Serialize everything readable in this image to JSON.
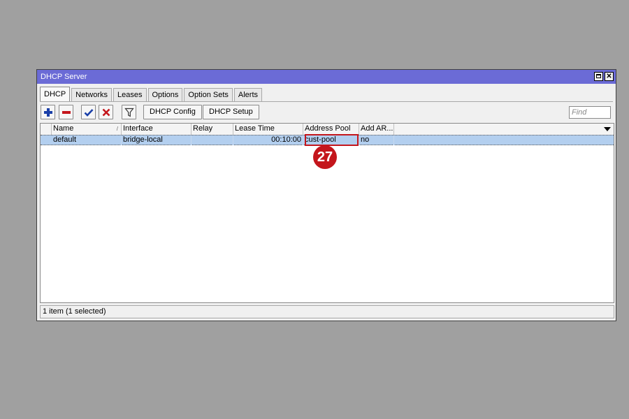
{
  "window": {
    "title": "DHCP Server"
  },
  "tabs": [
    {
      "label": "DHCP",
      "active": true
    },
    {
      "label": "Networks"
    },
    {
      "label": "Leases"
    },
    {
      "label": "Options"
    },
    {
      "label": "Option Sets"
    },
    {
      "label": "Alerts"
    }
  ],
  "toolbar": {
    "add_icon": "plus-icon",
    "remove_icon": "minus-icon",
    "enable_icon": "check-icon",
    "disable_icon": "x-icon",
    "filter_icon": "filter-icon",
    "dhcp_config_label": "DHCP Config",
    "dhcp_setup_label": "DHCP Setup",
    "find_placeholder": "Find"
  },
  "table": {
    "columns": [
      "Name",
      "Interface",
      "Relay",
      "Lease Time",
      "Address Pool",
      "Add AR..."
    ],
    "sort_indicator": "/",
    "rows": [
      {
        "name": "default",
        "interface": "bridge-local",
        "relay": "",
        "lease_time": "00:10:00",
        "address_pool": "cust-pool",
        "add_arp": "no"
      }
    ]
  },
  "status": {
    "text": "1 item (1 selected)"
  },
  "annotation": {
    "number": "27",
    "color": "#c4161c"
  },
  "colors": {
    "titlebar": "#6b6bd6",
    "selected_row": "#b3cfef",
    "background": "#a0a0a0"
  }
}
